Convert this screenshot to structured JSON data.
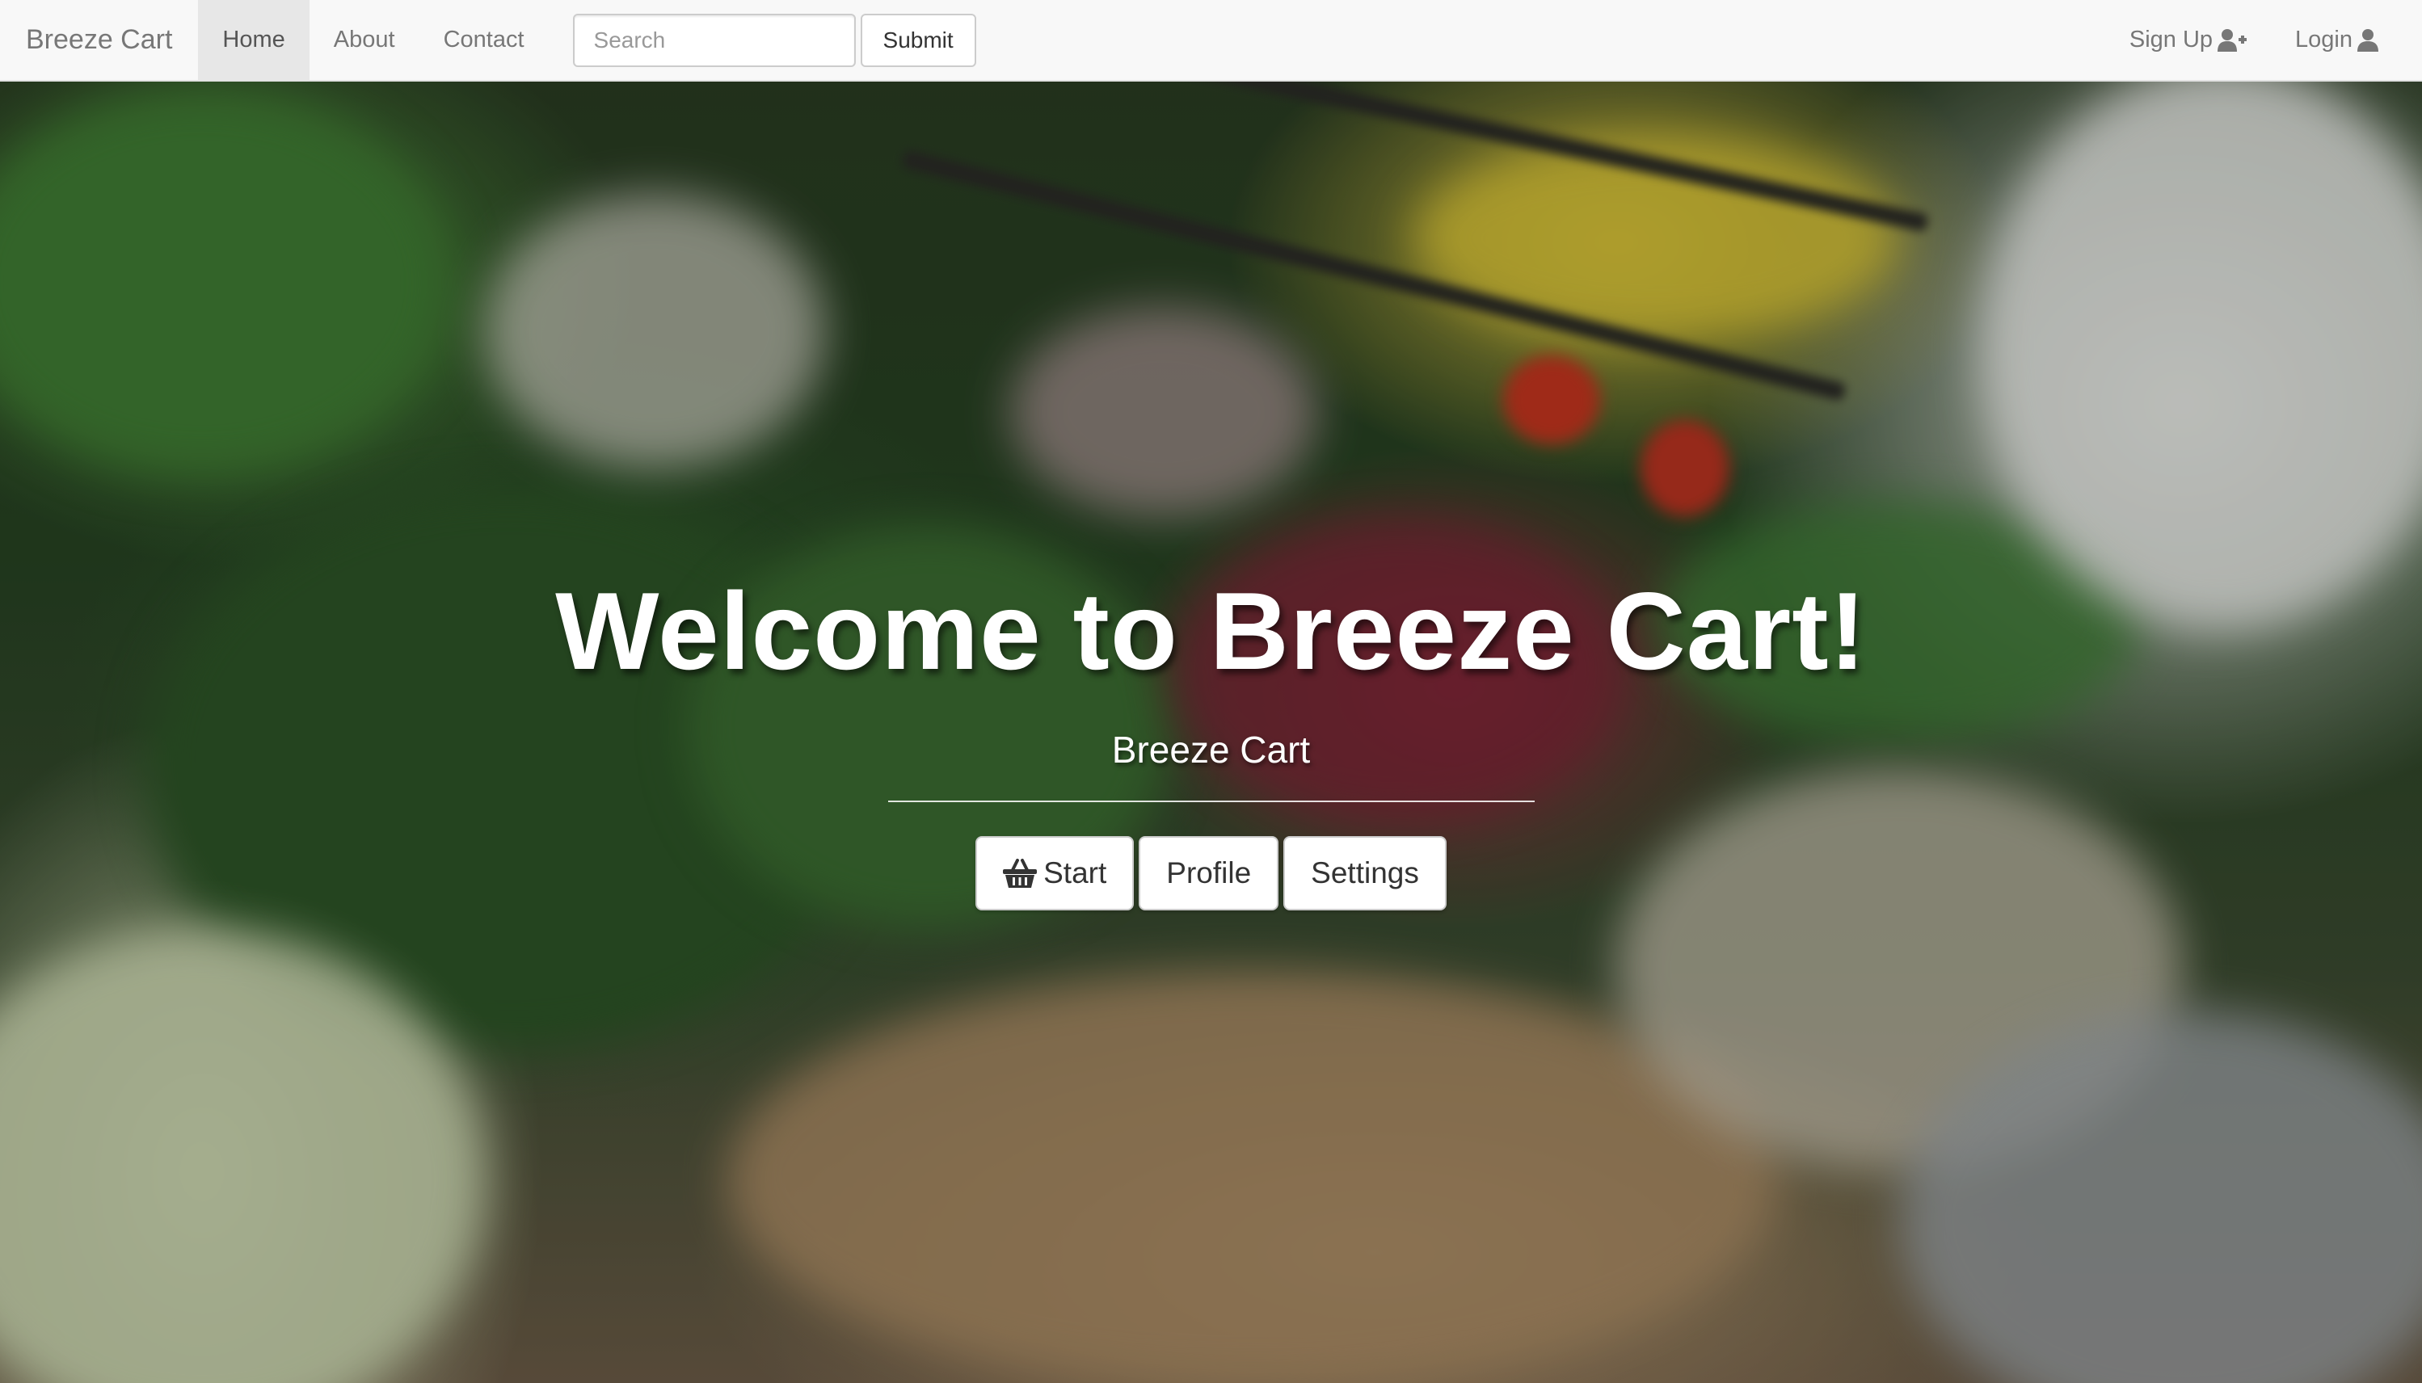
{
  "navbar": {
    "brand": "Breeze Cart",
    "links": [
      {
        "label": "Home",
        "active": true
      },
      {
        "label": "About",
        "active": false
      },
      {
        "label": "Contact",
        "active": false
      }
    ],
    "search": {
      "placeholder": "Search",
      "value": ""
    },
    "submit_label": "Submit",
    "right": {
      "signup_label": "Sign Up",
      "signup_icon": "user-plus-icon",
      "login_label": "Login",
      "login_icon": "user-icon"
    }
  },
  "hero": {
    "title": "Welcome to Breeze Cart!",
    "subtitle": "Breeze Cart",
    "buttons": [
      {
        "label": "Start",
        "icon": "shopping-basket-icon"
      },
      {
        "label": "Profile"
      },
      {
        "label": "Settings"
      }
    ]
  },
  "background": {
    "description_icon": "grocery-produce-photo"
  },
  "colors": {
    "navbar_bg": "#f8f8f8",
    "active_link_bg": "#e7e7e7",
    "link_text": "#777777",
    "hero_text": "#ffffff"
  }
}
